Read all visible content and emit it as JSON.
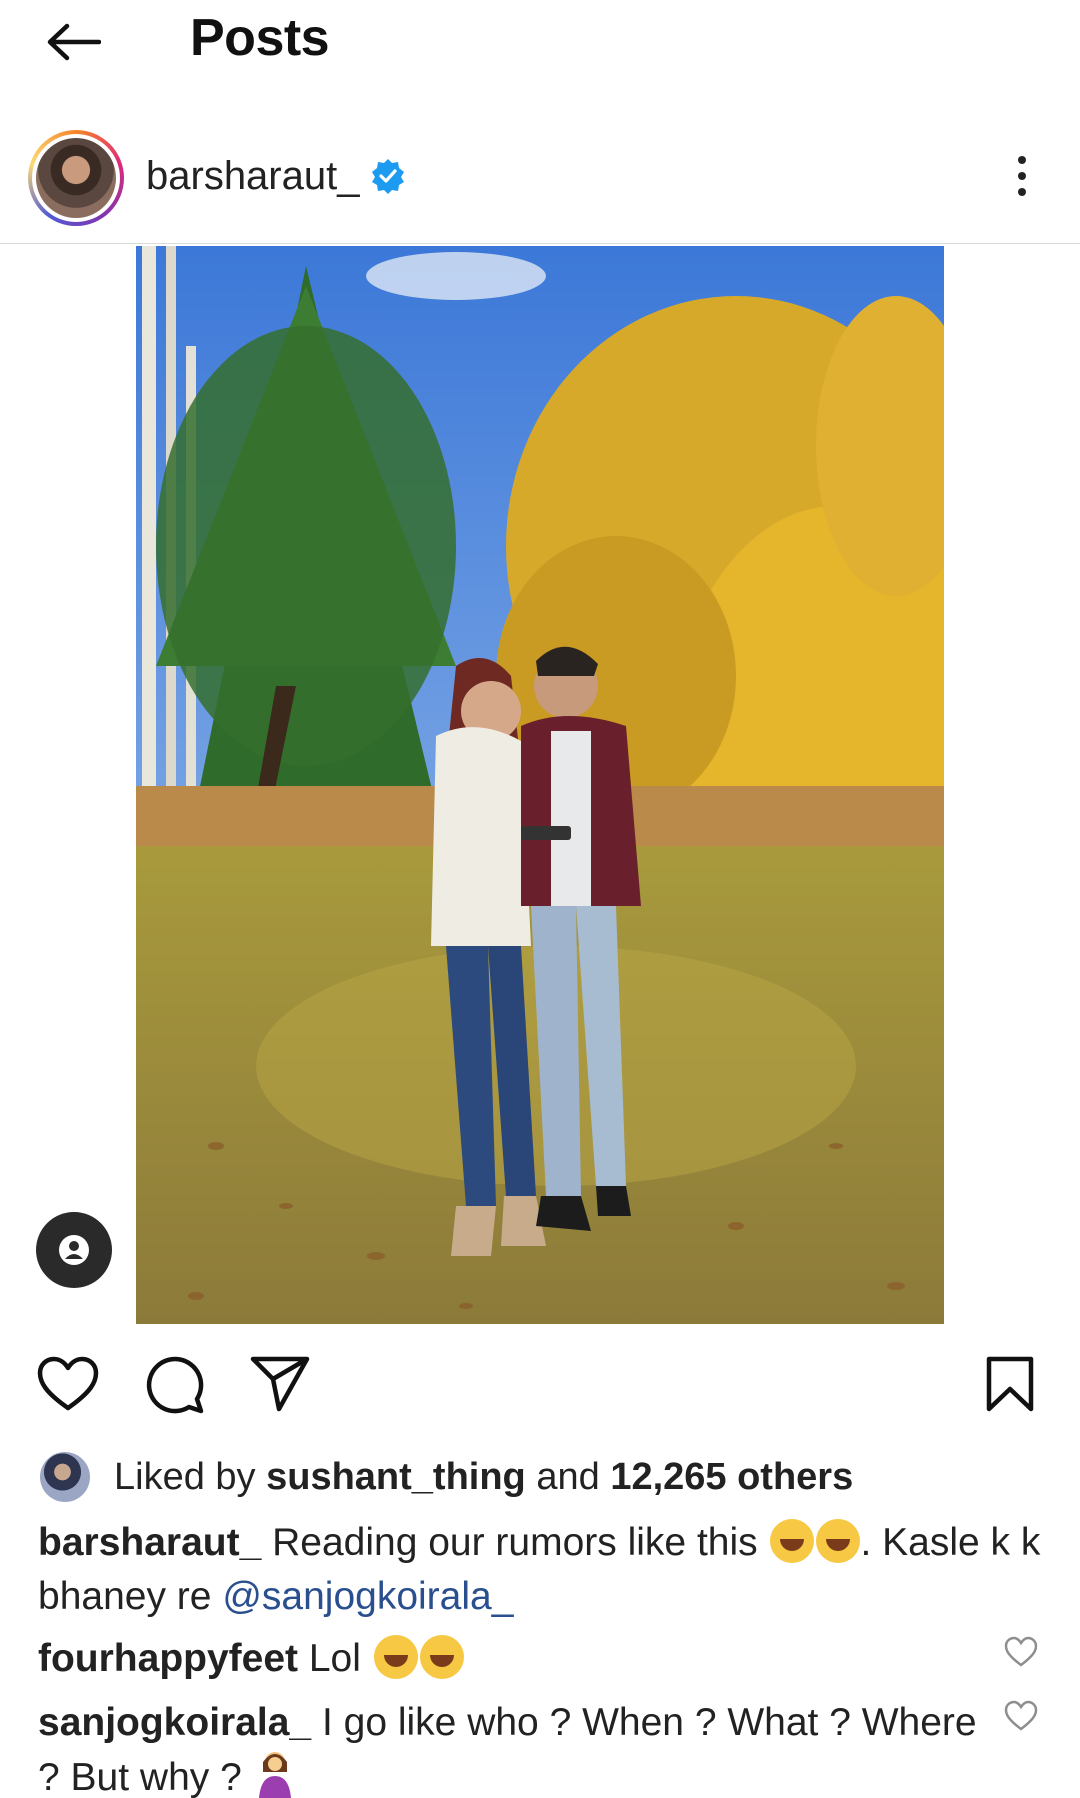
{
  "topbar": {
    "title": "Posts",
    "back_icon": "arrow-left-icon"
  },
  "post": {
    "username": "barsharaut_",
    "verified": true,
    "more_icon": "more-vertical-icon",
    "photo_alt": "Couple standing in an autumn park looking at a phone",
    "tag_icon": "user-tag-icon"
  },
  "actions": {
    "like_icon": "heart-icon",
    "comment_icon": "comment-icon",
    "share_icon": "send-icon",
    "save_icon": "bookmark-icon"
  },
  "likes": {
    "prefix": "Liked by ",
    "user": "sushant_thing",
    "middle": " and ",
    "count": "12,265 others"
  },
  "caption": {
    "username": "barsharaut_",
    "text_before": " Reading our rumors like this ",
    "text_after": ". Kasle k k bhaney re ",
    "mention": "@sanjogkoirala_"
  },
  "comments": [
    {
      "username": "fourhappyfeet",
      "text": " Lol "
    },
    {
      "username": "sanjogkoirala_",
      "text": " I go like who ? When ? What ? Where ? But why ? "
    }
  ],
  "colors": {
    "verified": "#1d9bf0",
    "mention": "#2a4f8f",
    "text": "#222222",
    "divider": "#dbdbdb"
  }
}
